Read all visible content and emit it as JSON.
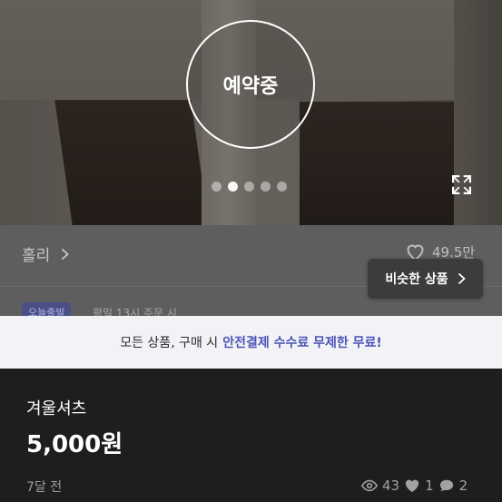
{
  "photo": {
    "status_badge": "예약중",
    "carousel_total": 5,
    "carousel_active_index": 1
  },
  "shop": {
    "name": "홀리",
    "likes": "49.5만"
  },
  "similar_button": {
    "label": "비슷한 상품"
  },
  "shipping": {
    "badge": "오늘출발",
    "text": "평일 13시 주문 시"
  },
  "notice": {
    "prefix": "모든 상품, 구매 시",
    "highlight": "안전결제 수수료 무제한 무료!"
  },
  "product": {
    "title": "겨울셔츠",
    "price": "5,000원",
    "posted": "7달 전",
    "views": "43",
    "favorites": "1",
    "chats": "2"
  },
  "icons": {
    "expand": "expand-icon",
    "chevron": "chevron-right-icon",
    "heart": "heart-icon",
    "eye": "eye-icon",
    "chat": "chat-bubble-icon"
  },
  "colors": {
    "accent": "#4c55b7",
    "notice_bg": "#f2f2f7",
    "product_bg": "#1e1e1e"
  }
}
